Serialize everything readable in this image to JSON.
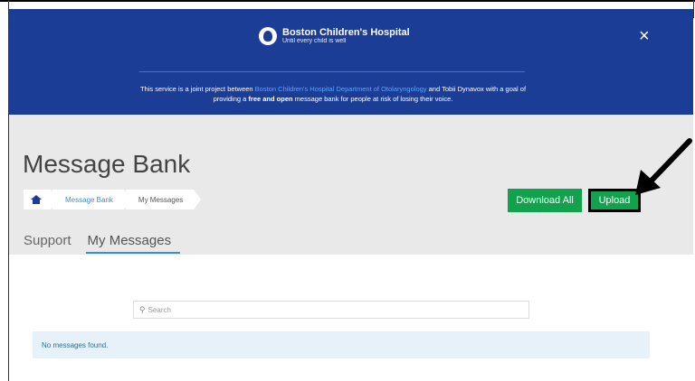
{
  "header": {
    "logo_name": "Boston Children's Hospital",
    "logo_tagline": "Until every child is well",
    "close_symbol": "×",
    "intro": {
      "part1": "This service is a joint project between ",
      "link": "Boston Children's Hospital Department of Otolaryngology",
      "part2": " and Tobii Dynavox with a goal of providing a ",
      "bold": "free and open",
      "part3": " message bank for people at risk of losing their voice."
    }
  },
  "page": {
    "title": "Message Bank"
  },
  "breadcrumb": {
    "home_icon": "home-icon",
    "items": [
      "Message Bank",
      "My Messages"
    ]
  },
  "actions": {
    "download_all": "Download All",
    "upload": "Upload"
  },
  "tabs": [
    "Support",
    "My Messages"
  ],
  "search": {
    "placeholder": "Search",
    "icon": "search-icon"
  },
  "messages": {
    "empty_text": "No messages found."
  },
  "colors": {
    "header_bg": "#1b3d96",
    "accent_green": "#12a14d",
    "link_blue": "#3a8fd2",
    "info_bg": "#e7f1fa"
  },
  "annotation": {
    "arrow": "pointer-arrow pointing to Upload"
  }
}
